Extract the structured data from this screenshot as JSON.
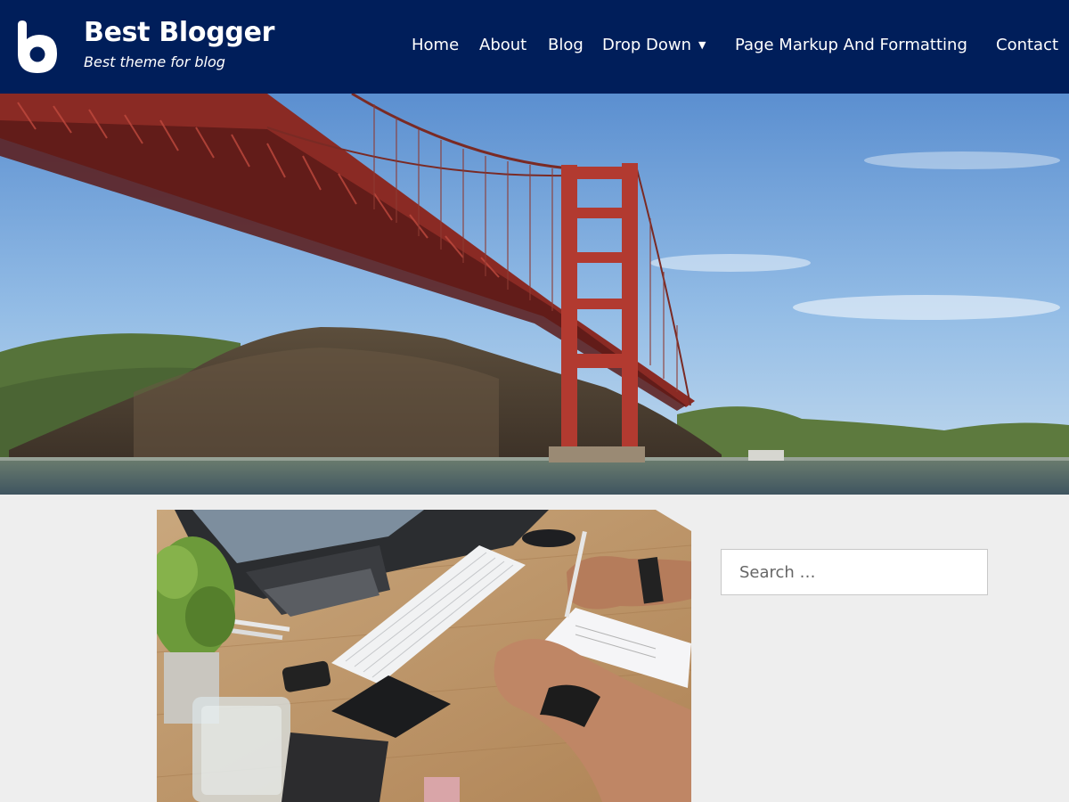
{
  "header": {
    "site_title": "Best Blogger",
    "tagline": "Best theme for blog",
    "logo_icon": "letter-b-logo-icon",
    "background_color": "#001e5a"
  },
  "nav": {
    "items": [
      {
        "label": "Home"
      },
      {
        "label": "About"
      },
      {
        "label": "Blog"
      },
      {
        "label": "Drop Down",
        "has_submenu": true,
        "submenu_icon": "caret-down-icon"
      },
      {
        "label": "Page Markup And Formatting"
      },
      {
        "label": "Contact"
      }
    ]
  },
  "hero": {
    "image_subject": "golden-gate-bridge-photo"
  },
  "main": {
    "featured_image": "desk-with-keyboard-and-notebook-photo"
  },
  "sidebar": {
    "search": {
      "placeholder": "Search …",
      "value": ""
    }
  },
  "colors": {
    "page_background": "#eeeeee",
    "header_background": "#001e5a"
  }
}
